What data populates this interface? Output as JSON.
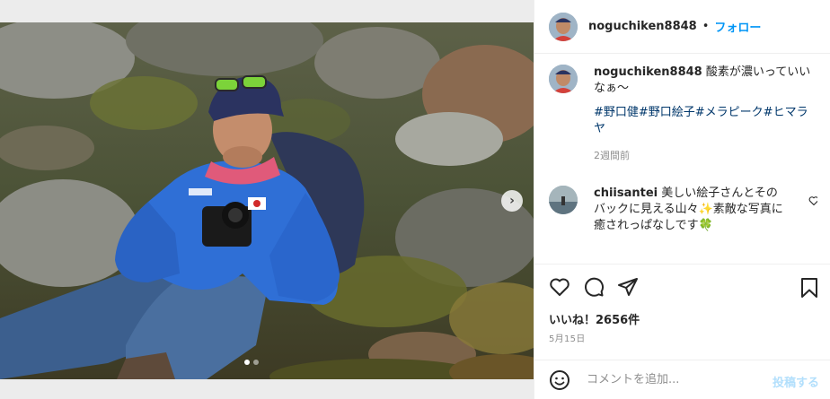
{
  "post": {
    "username": "noguchiken8848",
    "separator": "•",
    "follow_label": "フォロー",
    "caption": "酸素が濃いっていいなぁ〜",
    "hashtags": "#野口健#野口絵子#メラピーク#ヒマラヤ",
    "age": "2週間前"
  },
  "comment": {
    "username": "chiisantei",
    "text": "美しい絵子さんとそのバックに見える山々✨素敵な写真に癒されっぱなしです🍀"
  },
  "stats": {
    "likes": "いいね！2656件",
    "date": "5月15日"
  },
  "add_comment": {
    "placeholder": "コメントを追加...",
    "post_label": "投稿する"
  },
  "carousel": {
    "next_glyph": "›",
    "slide_count": 2,
    "active_index": 0
  },
  "colors": {
    "link": "#0095f6",
    "hashtag": "#00376b",
    "post_button_disabled": "#b2dffc",
    "jacket": "#2f6fd6"
  },
  "icons": [
    "heart-icon",
    "comment-icon",
    "share-icon",
    "bookmark-icon",
    "emoji-icon",
    "chevron-right-icon"
  ]
}
